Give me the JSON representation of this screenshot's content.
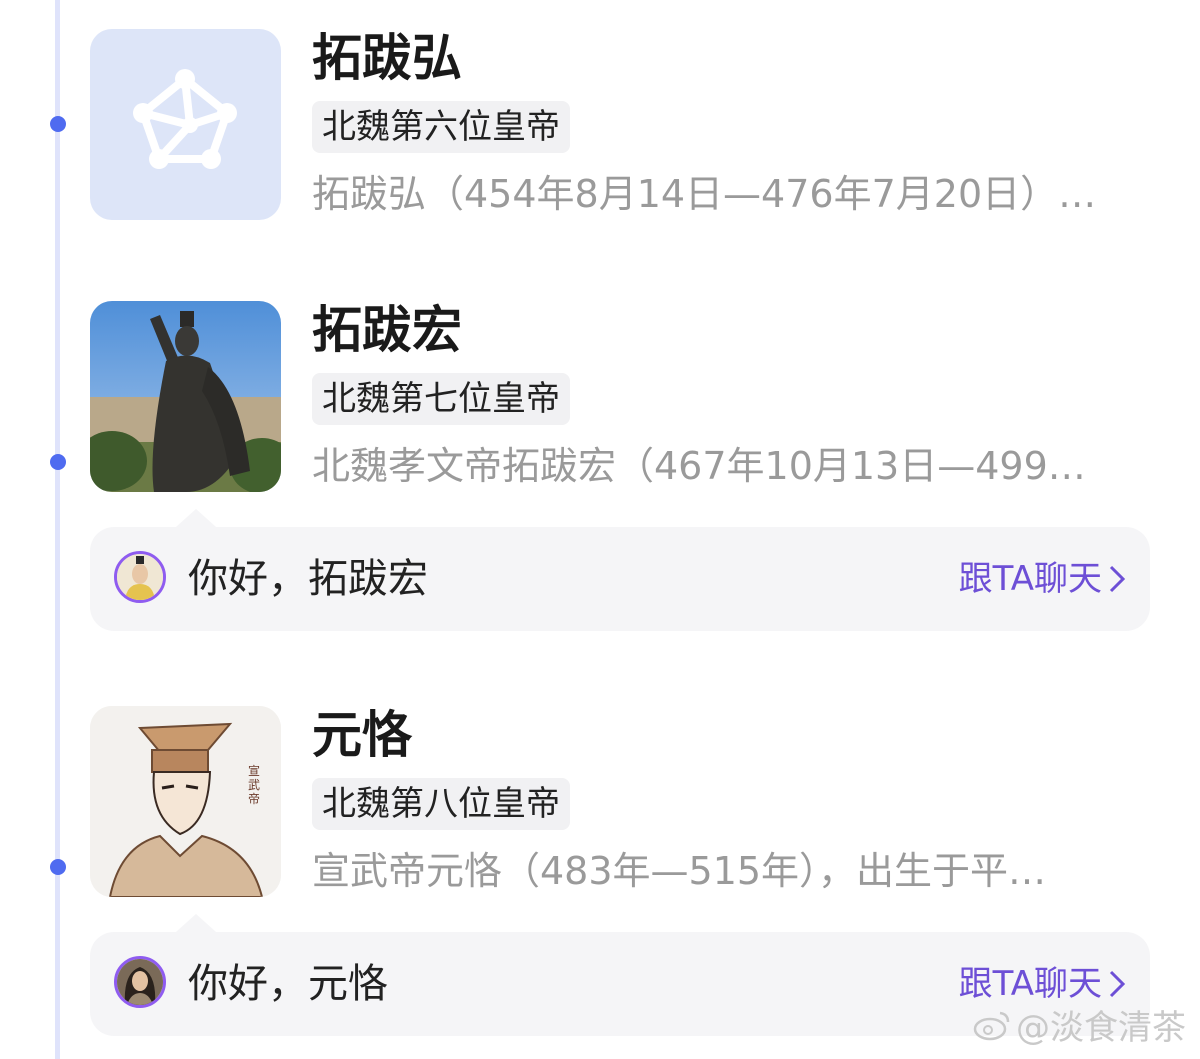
{
  "entries": [
    {
      "name": "拓跋弘",
      "tag": "北魏第六位皇帝",
      "description": "拓跋弘（454年8月14日—476年7月20日）…",
      "thumbnail": "placeholder-graph-icon"
    },
    {
      "name": "拓跋宏",
      "tag": "北魏第七位皇帝",
      "description": "北魏孝文帝拓跋宏（467年10月13日—499…",
      "thumbnail": "statue-photo",
      "chat": {
        "greeting": "你好，拓跋宏",
        "link_label": "跟TA聊天"
      }
    },
    {
      "name": "元恪",
      "tag": "北魏第八位皇帝",
      "description": "宣武帝元恪（483年—515年），出生于平…",
      "thumbnail": "portrait-drawing",
      "portrait_caption": "宣武帝",
      "chat": {
        "greeting": "你好，元恪",
        "link_label": "跟TA聊天"
      }
    }
  ],
  "watermark": {
    "text": "@淡食清茶",
    "icon": "weibo-icon"
  },
  "colors": {
    "timeline": "#dfe3fb",
    "dot": "#4f6bf0",
    "link": "#6d4fd6",
    "avatar_ring": "#8f5cf0"
  }
}
